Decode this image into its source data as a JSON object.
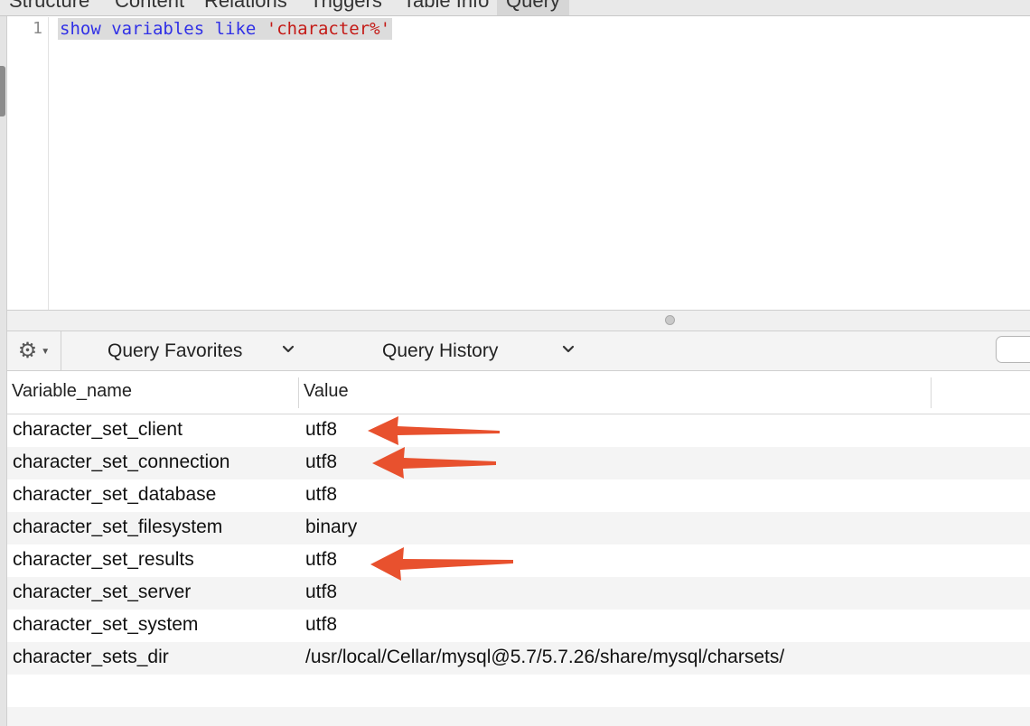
{
  "tabs": [
    {
      "label": "Structure"
    },
    {
      "label": "Content"
    },
    {
      "label": "Relations"
    },
    {
      "label": "Triggers"
    },
    {
      "label": "Table Info"
    },
    {
      "label": "Query"
    }
  ],
  "editor": {
    "line_number": "1",
    "keyword_text": "show variables like",
    "string_text": "'character%'"
  },
  "toolbar": {
    "gear_icon": "gear-icon",
    "query_favorites_label": "Query Favorites",
    "query_history_label": "Query History"
  },
  "results": {
    "columns": [
      "Variable_name",
      "Value"
    ],
    "rows": [
      {
        "name": "character_set_client",
        "value": "utf8"
      },
      {
        "name": "character_set_connection",
        "value": "utf8"
      },
      {
        "name": "character_set_database",
        "value": "utf8"
      },
      {
        "name": "character_set_filesystem",
        "value": "binary"
      },
      {
        "name": "character_set_results",
        "value": "utf8"
      },
      {
        "name": "character_set_server",
        "value": "utf8"
      },
      {
        "name": "character_set_system",
        "value": "utf8"
      },
      {
        "name": "character_sets_dir",
        "value": "/usr/local/Cellar/mysql@5.7/5.7.26/share/mysql/charsets/"
      }
    ]
  },
  "annotations": {
    "arrow_color": "#e8512e",
    "highlighted_rows": [
      "character_set_client",
      "character_set_connection",
      "character_set_results"
    ]
  }
}
